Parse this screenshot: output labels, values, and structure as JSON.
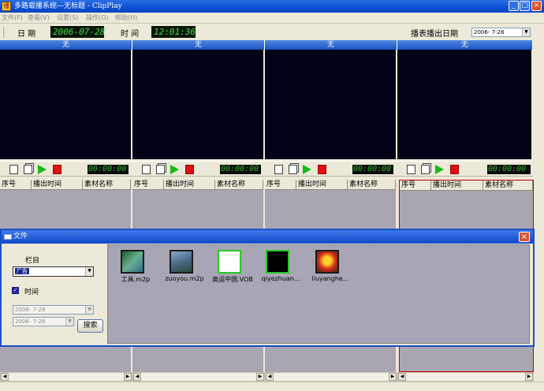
{
  "window": {
    "title": "多路载播系统---无标题 - ClipPlay",
    "icon": "app-icon",
    "buttons": [
      "_",
      "□",
      "×"
    ]
  },
  "menu": [
    "文件(F)",
    "查看(V)",
    "设置(S)",
    "操作(O)",
    "帮助(H)"
  ],
  "toolbar": {
    "date_label": "日 期",
    "date_value": "2006-07-28",
    "time_label": "时 间",
    "time_value": "12:01:36",
    "play_date_label": "播表播出日期",
    "play_date_value": "2006- 7-28"
  },
  "channels": [
    {
      "header": "无",
      "timecode": "00:00:00"
    },
    {
      "header": "无",
      "timecode": "00:00:00"
    },
    {
      "header": "无",
      "timecode": "00:00:00"
    },
    {
      "header": "无",
      "timecode": "00:00:00"
    }
  ],
  "list_columns": [
    "序号",
    "播出时间",
    "素材名称"
  ],
  "dialog": {
    "title": "文件",
    "category_label": "栏目",
    "category_value": "广告",
    "time_label": "时间",
    "time_checked": true,
    "date_from": "2006- 7-28",
    "date_to": "2006- 7-28",
    "search_label": "搜索",
    "files": [
      {
        "name": "工具.m2p",
        "icon": "video-thumbnail-icon"
      },
      {
        "name": "zuoyou.m2p",
        "icon": "video-thumbnail-icon"
      },
      {
        "name": "奥运中国.VOB",
        "icon": "video-thumbnail-icon"
      },
      {
        "name": "qiyezhuan...",
        "icon": "video-thumbnail-icon"
      },
      {
        "name": "liuyanghe...",
        "icon": "video-thumbnail-icon"
      }
    ]
  },
  "colors": {
    "title_blue": "#0b4fd4",
    "lcd_green": "#3de03d",
    "screen_bg": "#020218",
    "list_bg": "#a7a6b1",
    "selected_border": "#c00000"
  }
}
